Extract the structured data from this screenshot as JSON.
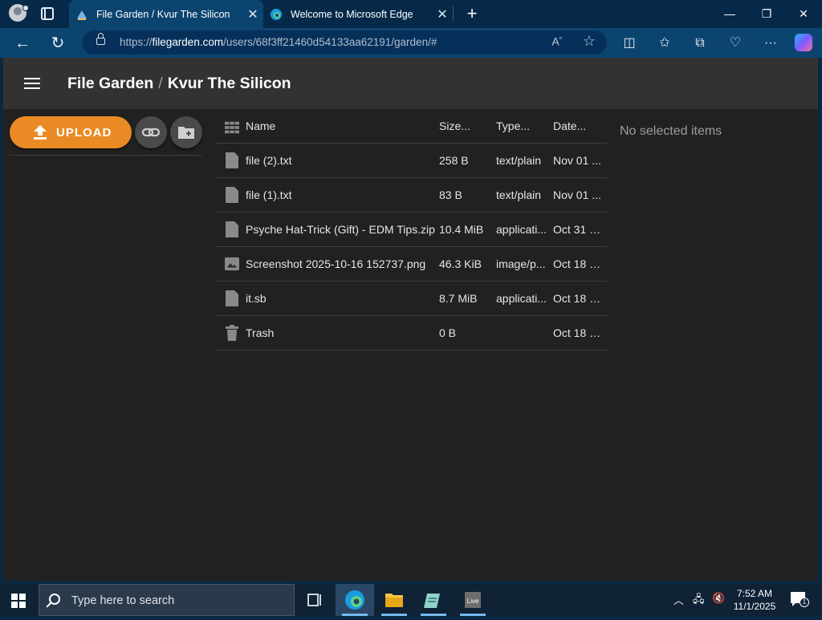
{
  "browser": {
    "tabs": [
      {
        "title": "File Garden / Kvur The Silicon",
        "active": true
      },
      {
        "title": "Welcome to Microsoft Edge",
        "active": false
      }
    ],
    "address": {
      "prefix": "https://",
      "host": "filegarden.com",
      "path": "/users/68f3ff21460d54133aa62191/garden/#"
    }
  },
  "app": {
    "title": "File Garden",
    "breadcrumb": "Kvur The Silicon",
    "upload_label": "UPLOAD",
    "accent_color": "#e98a24",
    "columns": {
      "name": "Name",
      "size": "Size...",
      "type": "Type...",
      "date": "Date..."
    },
    "files": [
      {
        "icon": "file-icon",
        "name": "file (2).txt",
        "size": "258 B",
        "type": "text/plain",
        "date": "Nov 01 ..."
      },
      {
        "icon": "file-icon",
        "name": "file (1).txt",
        "size": "83 B",
        "type": "text/plain",
        "date": "Nov 01 ..."
      },
      {
        "icon": "file-icon",
        "name": "Psyche Hat-Trick (Gift) - EDM Tips.zip",
        "size": "10.4 MiB",
        "type": "applicati...",
        "date": "Oct 31 2..."
      },
      {
        "icon": "image-icon",
        "name": "Screenshot 2025-10-16 152737.png",
        "size": "46.3 KiB",
        "type": "image/p...",
        "date": "Oct 18 2..."
      },
      {
        "icon": "file-icon",
        "name": "it.sb",
        "size": "8.7 MiB",
        "type": "applicati...",
        "date": "Oct 18 2..."
      },
      {
        "icon": "trash-icon",
        "name": "Trash",
        "size": "0 B",
        "type": "",
        "date": "Oct 18 2..."
      }
    ],
    "empty_selection": "No selected items"
  },
  "taskbar": {
    "search_placeholder": "Type here to search",
    "time": "7:52 AM",
    "date": "11/1/2025",
    "notification_count": "1"
  }
}
